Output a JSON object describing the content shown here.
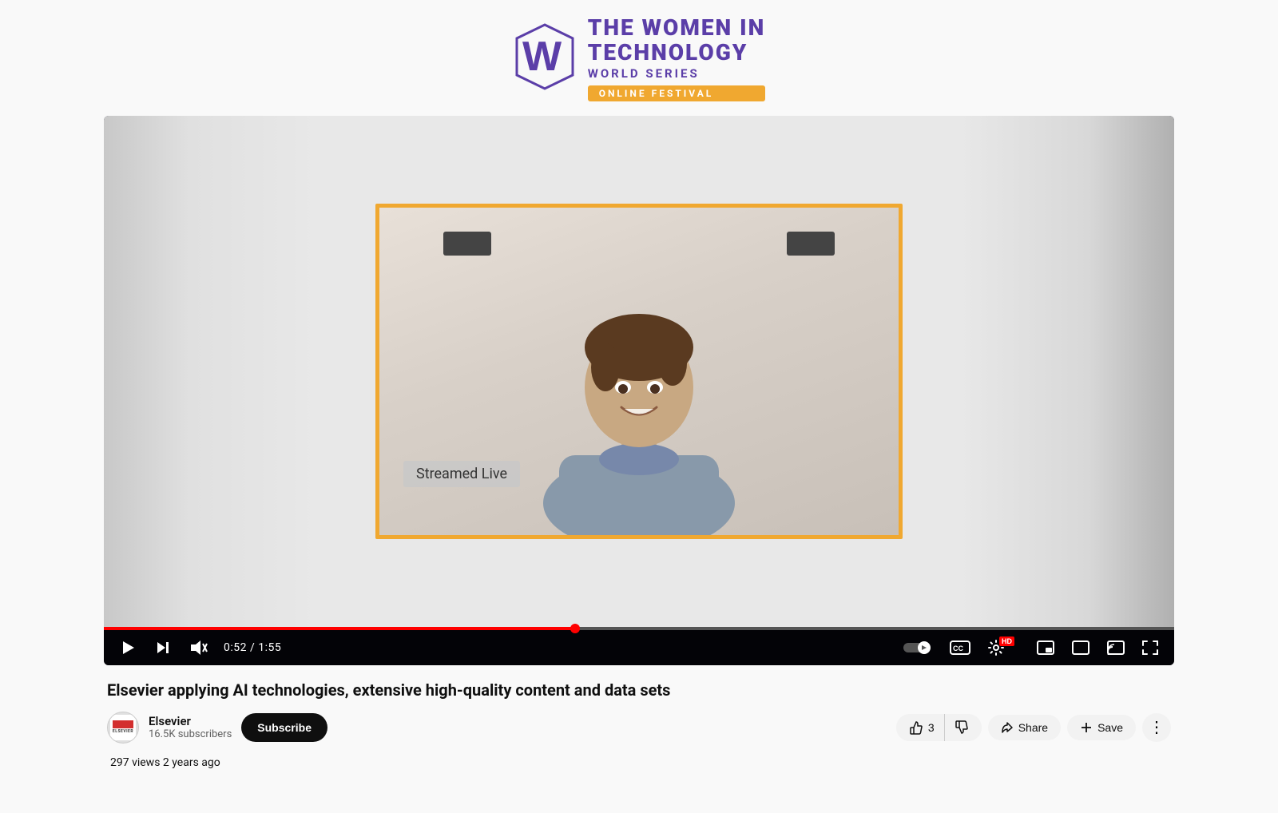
{
  "logo": {
    "line1": "THE WOMEN IN",
    "line2": "TECHNOLOGY",
    "subtitle": "WORLD SERIES",
    "badge": "Online Festival"
  },
  "video": {
    "streamed_live_label": "Streamed Live",
    "progress_current": "0:52",
    "progress_total": "1:55",
    "progress_percent": 44
  },
  "video_info": {
    "title": "Elsevier applying AI technologies, extensive high-quality content and data sets",
    "channel_name": "Elsevier",
    "channel_subs": "16.5K subscribers",
    "subscribe_label": "Subscribe",
    "like_count": "3",
    "stats": "297 views  2 years ago"
  },
  "actions": {
    "like_label": "3",
    "share_label": "Share",
    "save_label": "Save"
  },
  "controls": {
    "play_label": "Play",
    "next_label": "Next",
    "mute_label": "Mute",
    "autoplay_label": "Autoplay",
    "cc_label": "Subtitles",
    "settings_label": "Settings",
    "miniplayer_label": "Miniplayer",
    "theater_label": "Theater mode",
    "cast_label": "Cast",
    "fullscreen_label": "Fullscreen"
  }
}
